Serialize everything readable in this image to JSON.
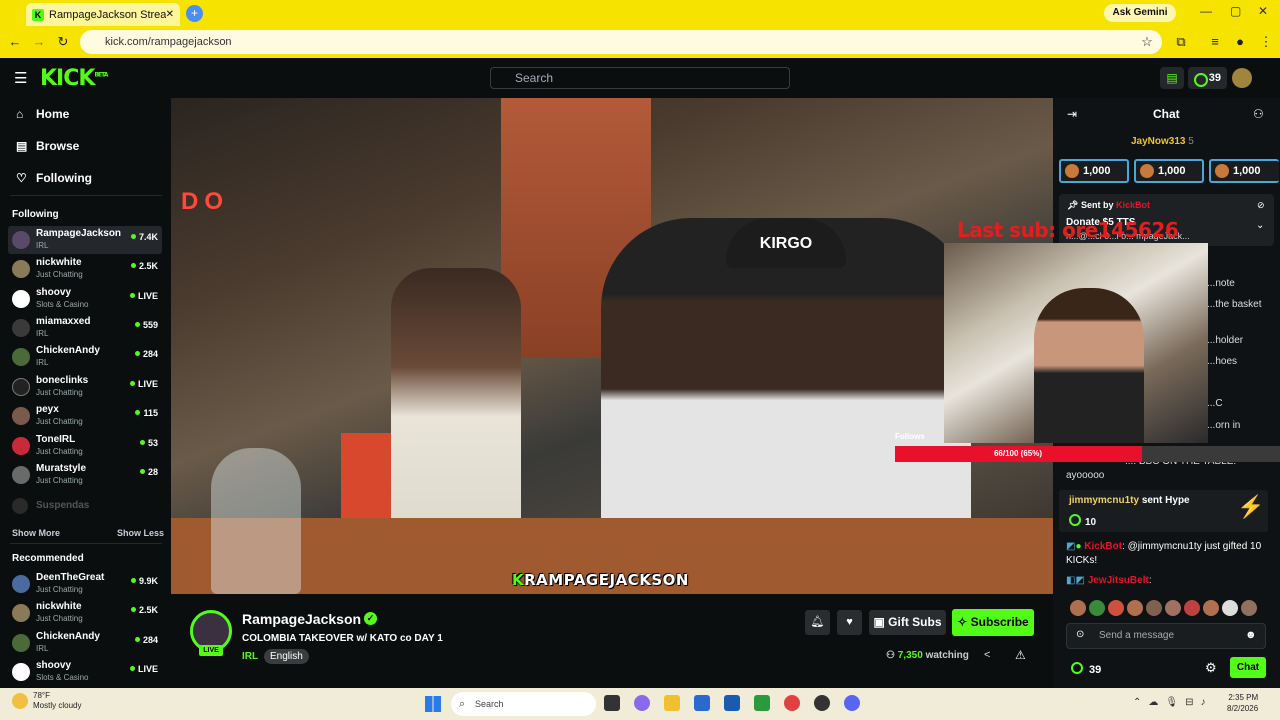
{
  "browser": {
    "tab_title": "RampageJackson Stream - 🔊",
    "url": "kick.com/rampagejackson",
    "gemini_label": "Ask Gemini"
  },
  "header": {
    "logo": "KICK",
    "logo_sup": "BETA",
    "search_placeholder": "Search",
    "kicks_count": "39"
  },
  "sidebar": {
    "nav": [
      {
        "label": "Home",
        "icon": "home-icon"
      },
      {
        "label": "Browse",
        "icon": "browse-icon"
      },
      {
        "label": "Following",
        "icon": "heart-icon"
      }
    ],
    "following_title": "Following",
    "following": [
      {
        "name": "RampageJackson",
        "category": "IRL",
        "viewers": "7.4K"
      },
      {
        "name": "nickwhite",
        "category": "Just Chatting",
        "viewers": "2.5K"
      },
      {
        "name": "shoovy",
        "category": "Slots & Casino",
        "viewers": "LIVE"
      },
      {
        "name": "miamaxxed",
        "category": "IRL",
        "viewers": "559"
      },
      {
        "name": "ChickenAndy",
        "category": "IRL",
        "viewers": "284"
      },
      {
        "name": "boneclinks",
        "category": "Just Chatting",
        "viewers": "LIVE"
      },
      {
        "name": "peyx",
        "category": "Just Chatting",
        "viewers": "115"
      },
      {
        "name": "ToneIRL",
        "category": "Just Chatting",
        "viewers": "53"
      },
      {
        "name": "Muratstyle",
        "category": "Just Chatting",
        "viewers": "28"
      }
    ],
    "suspended_label": "Suspendas",
    "show_more": "Show More",
    "show_less": "Show Less",
    "recommended_title": "Recommended",
    "recommended": [
      {
        "name": "DeenTheGreat",
        "category": "Just Chatting",
        "viewers": "9.9K"
      },
      {
        "name": "nickwhite",
        "category": "Just Chatting",
        "viewers": "2.5K"
      },
      {
        "name": "ChickenAndy",
        "category": "IRL",
        "viewers": "284"
      },
      {
        "name": "shoovy",
        "category": "Slots & Casino",
        "viewers": "LIVE"
      }
    ]
  },
  "video": {
    "streamer_tag_k": "K",
    "streamer_tag_rest": "RAMPAGEJACKSON",
    "hat_text": "KIRGO",
    "last_sub": "Last sub: ore145626",
    "follows_label": "Follows",
    "follows_goal": "66/100 (65%)",
    "follows_fraction": 0.66
  },
  "stream": {
    "channel": "RampageJackson",
    "live": "LIVE",
    "title": "COLOMBIA TAKEOVER w/ KATO co  DAY 1",
    "category": "IRL",
    "language": "English",
    "gift_label": "Gift Subs",
    "subscribe_label": "Subscribe",
    "viewers": "7,350",
    "watching_label": "watching"
  },
  "chat": {
    "title": "Chat",
    "pinned_user": "JayNow313",
    "pinned_count": "5",
    "top_pills": [
      "1,000",
      "1,000",
      "1,000"
    ],
    "sent_by_label": "Sent by",
    "sent_by_user": "KickBot",
    "pinned_msg": "Donate $5 TTS",
    "pinned_msg2": "h...@...cl 0...i o... mpageJack...",
    "partial_lines": [
      "...note",
      "...the basket",
      "...holder",
      "...hoes",
      "...C",
      "...orn in"
    ],
    "msg_bbc": "...: BBC ON THE TABLE!",
    "msg_ayo": "ayooooo",
    "hype_user": "jimmymcnu1ty",
    "hype_action": "sent",
    "hype_item": "Hype",
    "hype_amount": "10",
    "kickbot_user": "KickBot",
    "kickbot_msg": "@jimmymcnu1ty just gifted 10 KICKs!",
    "last_user": "JewJitsuBelt",
    "input_placeholder": "Send a message",
    "kicks": "39",
    "chat_button": "Chat"
  },
  "taskbar": {
    "temp": "78°F",
    "weather": "Mostly cloudy",
    "search": "Search",
    "time": "2:35 PM",
    "date": "8/2/2026"
  },
  "colors": {
    "accent": "#53fc18",
    "chrome": "#f7e300",
    "background": "#0b0e0f"
  }
}
